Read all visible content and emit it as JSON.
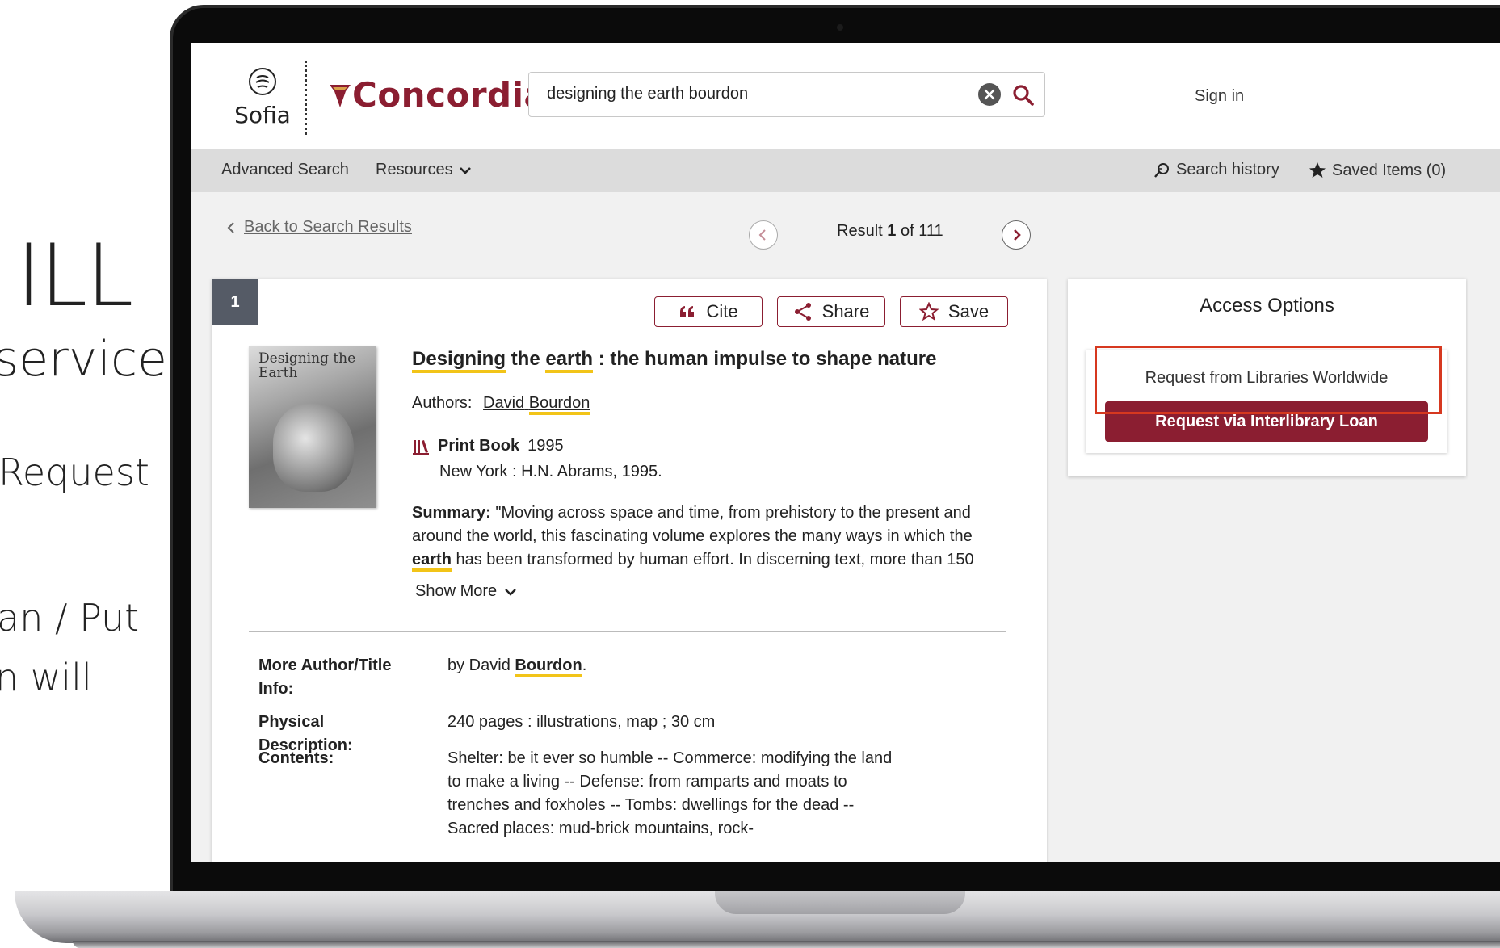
{
  "slide": {
    "heading": "ILL",
    "subheading": "service",
    "line1": "Request",
    "line2": "an / Put",
    "line3": "n will"
  },
  "header": {
    "sofia_label": "Sofia",
    "brand": "Concordia",
    "search_value": "designing the earth bourdon",
    "sign_in": "Sign in"
  },
  "nav": {
    "advanced_search": "Advanced Search",
    "resources": "Resources",
    "search_history": "Search history",
    "saved_items": "Saved Items (0)"
  },
  "result_nav": {
    "back_label": "Back to Search Results",
    "result_prefix": "Result",
    "result_current": "1",
    "result_suffix": "of 111"
  },
  "record": {
    "index": "1",
    "actions": {
      "cite": "Cite",
      "share": "Share",
      "save": "Save"
    },
    "cover_text": "Designing the Earth",
    "title_w1": "Designing",
    "title_w2": "the",
    "title_w3": "earth",
    "title_rest": ": the human impulse to shape nature",
    "authors_label": "Authors:",
    "author_first": "David",
    "author_last": "Bourdon",
    "format": "Print Book",
    "year": "1995",
    "publisher": "New York : H.N. Abrams, 1995.",
    "summary_label": "Summary:",
    "summary_part1": "\"Moving across space and time, from prehistory to the present and around the world, this fascinating volume explores the many ways in which the",
    "summary_hl": "earth",
    "summary_part2": "has been transformed by human effort. In discerning text, more than 150",
    "show_more": "Show More",
    "details": {
      "more_info_label": "More Author/Title Info:",
      "more_info_prefix": "by David",
      "more_info_hl": "Bourdon",
      "more_info_suffix": ".",
      "physical_label": "Physical Description:",
      "physical_value": "240 pages : illustrations, map ; 30 cm",
      "contents_label": "Contents:",
      "contents_value": "Shelter: be it ever so humble -- Commerce: modifying the land to make a living -- Defense: from ramparts and moats to trenches and foxholes -- Tombs: dwellings for the dead -- Sacred places: mud-brick mountains, rock-"
    }
  },
  "access": {
    "title": "Access Options",
    "request_label": "Request from Libraries Worldwide",
    "ill_button": "Request via Interlibrary Loan"
  },
  "colors": {
    "brand": "#8b1e31",
    "highlight": "#f2c418",
    "callout": "#d6381f",
    "navbar": "#dcdcdc"
  }
}
